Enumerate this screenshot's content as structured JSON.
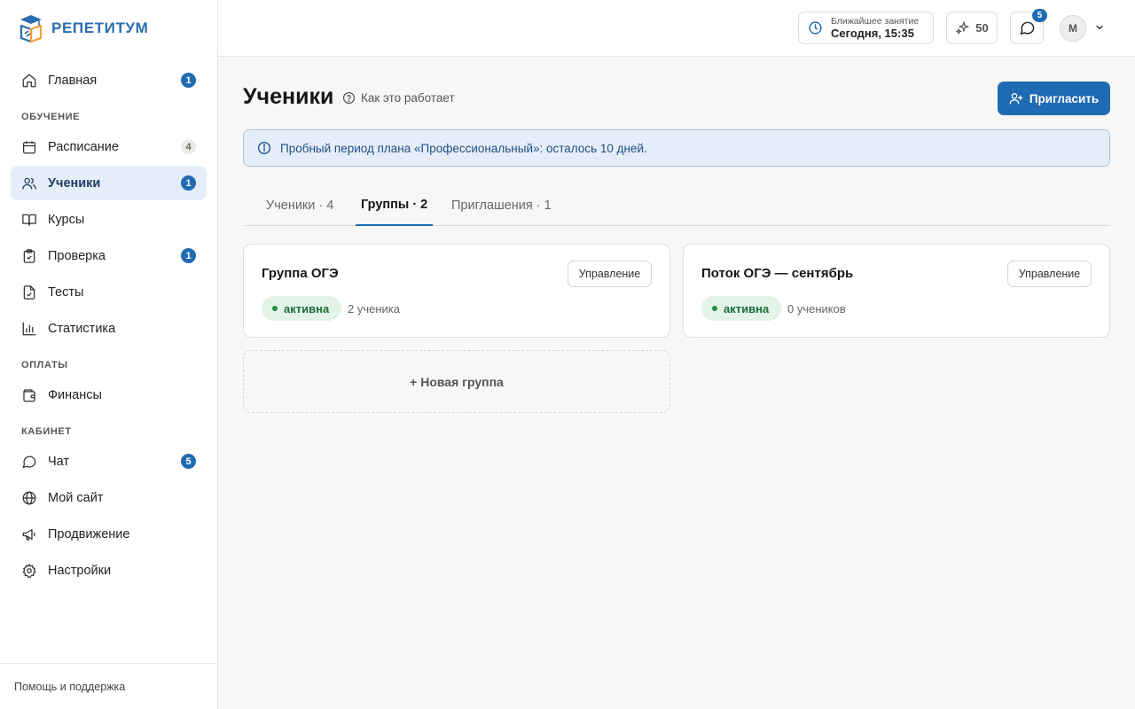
{
  "brand": {
    "name": "РЕПЕТИТУМ"
  },
  "sidebar": {
    "items": [
      {
        "label": "Главная",
        "badge": "1"
      },
      {
        "section": "ОБУЧЕНИЕ"
      },
      {
        "label": "Расписание",
        "badge": "4"
      },
      {
        "label": "Ученики",
        "badge": "1"
      },
      {
        "label": "Курсы"
      },
      {
        "label": "Проверка",
        "badge": "1"
      },
      {
        "label": "Тесты"
      },
      {
        "label": "Статистика"
      },
      {
        "section": "ОПЛАТЫ"
      },
      {
        "label": "Финансы"
      },
      {
        "section": "КАБИНЕТ"
      },
      {
        "label": "Чат",
        "badge": "5"
      },
      {
        "label": "Мой сайт"
      },
      {
        "label": "Продвижение"
      },
      {
        "label": "Настройки"
      }
    ],
    "footer": "Помощь и поддержка"
  },
  "header": {
    "next_lesson_label": "Ближайшее занятие",
    "next_lesson_value": "Сегодня, 15:35",
    "points": "50",
    "chat_badge": "5",
    "avatar_initial": "М"
  },
  "main": {
    "title": "Ученики",
    "how_it_works": "Как это работает",
    "invite_button": "Пригласить",
    "trial_banner": "Пробный период плана «Профессиональный»: осталось 10 дней.",
    "tabs": [
      {
        "label": "Ученики · 4"
      },
      {
        "label": "Группы · 2"
      },
      {
        "label": "Приглашения · 1"
      }
    ],
    "groups": [
      {
        "name": "Группа ОГЭ",
        "status": "активна",
        "count": "2 ученика",
        "manage": "Управление"
      },
      {
        "name": "Поток ОГЭ — сентябрь",
        "status": "активна",
        "count": "0 учеников",
        "manage": "Управление"
      }
    ],
    "new_group": "+ Новая группа"
  },
  "colors": {
    "accent": "#1f6bb3",
    "active_bg": "#e5eef8",
    "status_green": "#1b6e3a",
    "status_bg": "#e3f3e8"
  }
}
